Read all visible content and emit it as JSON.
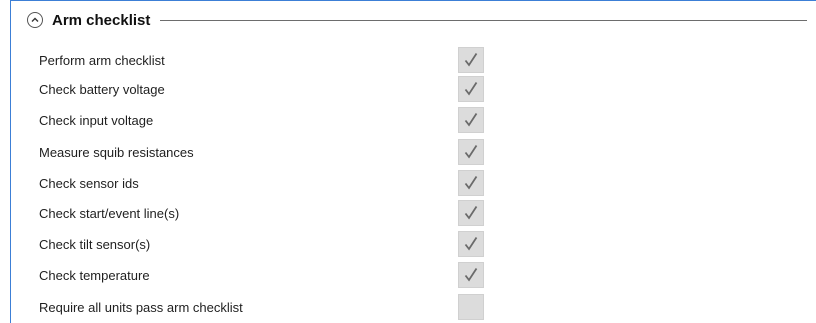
{
  "section": {
    "title": "Arm checklist",
    "collapse_icon": "chevron-up-icon"
  },
  "items": [
    {
      "label": "Perform arm checklist",
      "checked": true
    },
    {
      "label": "Check battery voltage",
      "checked": true
    },
    {
      "label": "Check input voltage",
      "checked": true
    },
    {
      "label": "Measure squib resistances",
      "checked": true
    },
    {
      "label": "Check sensor ids",
      "checked": true
    },
    {
      "label": "Check start/event line(s)",
      "checked": true
    },
    {
      "label": "Check tilt sensor(s)",
      "checked": true
    },
    {
      "label": "Check temperature",
      "checked": true
    },
    {
      "label": "Require all units pass arm checklist",
      "checked": false
    }
  ],
  "colors": {
    "frame_accent": "#3c7fd6",
    "checkbox_fill": "#dcdcdc",
    "checkmark": "#6a6a6a"
  }
}
